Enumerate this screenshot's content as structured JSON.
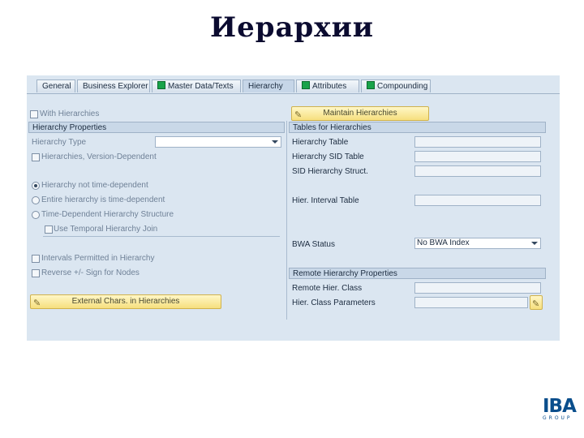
{
  "slide": {
    "title": "Иерархии"
  },
  "tabs": [
    {
      "label": "General",
      "indicator": false,
      "active": false
    },
    {
      "label": "Business Explorer",
      "indicator": false,
      "active": false
    },
    {
      "label": "Master Data/Texts",
      "indicator": true,
      "active": false
    },
    {
      "label": "Hierarchy",
      "indicator": false,
      "active": true
    },
    {
      "label": "Attributes",
      "indicator": true,
      "active": false
    },
    {
      "label": "Compounding",
      "indicator": true,
      "active": false
    }
  ],
  "left": {
    "with_hierarchies": "With Hierarchies",
    "section_title": "Hierarchy Properties",
    "hierarchy_type_label": "Hierarchy Type",
    "hierarchy_type_value": "",
    "version_dependent": "Hierarchies, Version-Dependent",
    "radio_not_time": "Hierarchy not time-dependent",
    "radio_entire_time": "Entire hierarchy is time-dependent",
    "radio_time_structure": "Time-Dependent Hierarchy Structure",
    "temporal_join": "Use Temporal Hierarchy Join",
    "intervals": "Intervals Permitted in Hierarchy",
    "reverse_sign": "Reverse +/- Sign for Nodes",
    "external_chars_button": "External Chars. in Hierarchies"
  },
  "right": {
    "maintain_button": "Maintain Hierarchies",
    "tables_section": "Tables for Hierarchies",
    "hierarchy_table": "Hierarchy Table",
    "hierarchy_sid_table": "Hierarchy SID Table",
    "sid_hierarchy_struct": "SID Hierarchy Struct.",
    "hier_interval_table": "Hier. Interval Table",
    "bwa_status_label": "BWA Status",
    "bwa_status_value": "No BWA Index",
    "remote_section": "Remote Hierarchy Properties",
    "remote_hier_class": "Remote Hier. Class",
    "hier_class_params": "Hier. Class Parameters"
  },
  "logo": {
    "main": "IBA",
    "sub": "GROUP"
  },
  "colors": {
    "indicator": "#19a34a",
    "button": "#f6df7e",
    "panel": "#dbe6f1"
  }
}
